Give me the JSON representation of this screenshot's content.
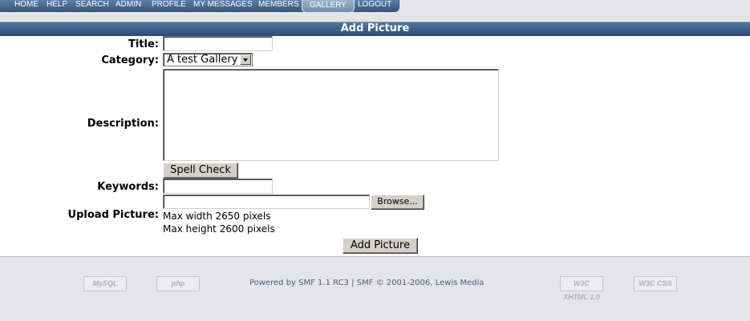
{
  "nav": {
    "items": [
      "HOME",
      "HELP",
      "SEARCH",
      "ADMIN",
      "PROFILE",
      "MY MESSAGES",
      "MEMBERS",
      "GALLERY",
      "LOGOUT"
    ],
    "active": "GALLERY"
  },
  "header": {
    "title": "Add Picture"
  },
  "form": {
    "title_label": "Title:",
    "title_value": "",
    "category_label": "Category:",
    "category_selected": "A test Gallery",
    "description_label": "Description:",
    "description_value": "",
    "spell_check_label": "Spell Check",
    "keywords_label": "Keywords:",
    "keywords_value": "",
    "upload_label": "Upload Picture:",
    "browse_label": "Browse...",
    "max_width_note": "Max width 2650 pixels",
    "max_height_note": "Max height 2600 pixels",
    "submit_label": "Add Picture"
  },
  "footer": {
    "mysql_badge": "MySQL",
    "php_badge": "php",
    "powered_link": "Powered by SMF 1.1 RC3",
    "separator": "|",
    "copyright_link": "SMF © 2001-2006, Lewis Media",
    "xhtml_badge": "W3C XHTML 1.0",
    "css_badge": "W3C CSS"
  },
  "colors": {
    "header": "#2b4c74",
    "nav": "#37587f",
    "link": "#475f7e",
    "background": "#e5e5e8"
  }
}
